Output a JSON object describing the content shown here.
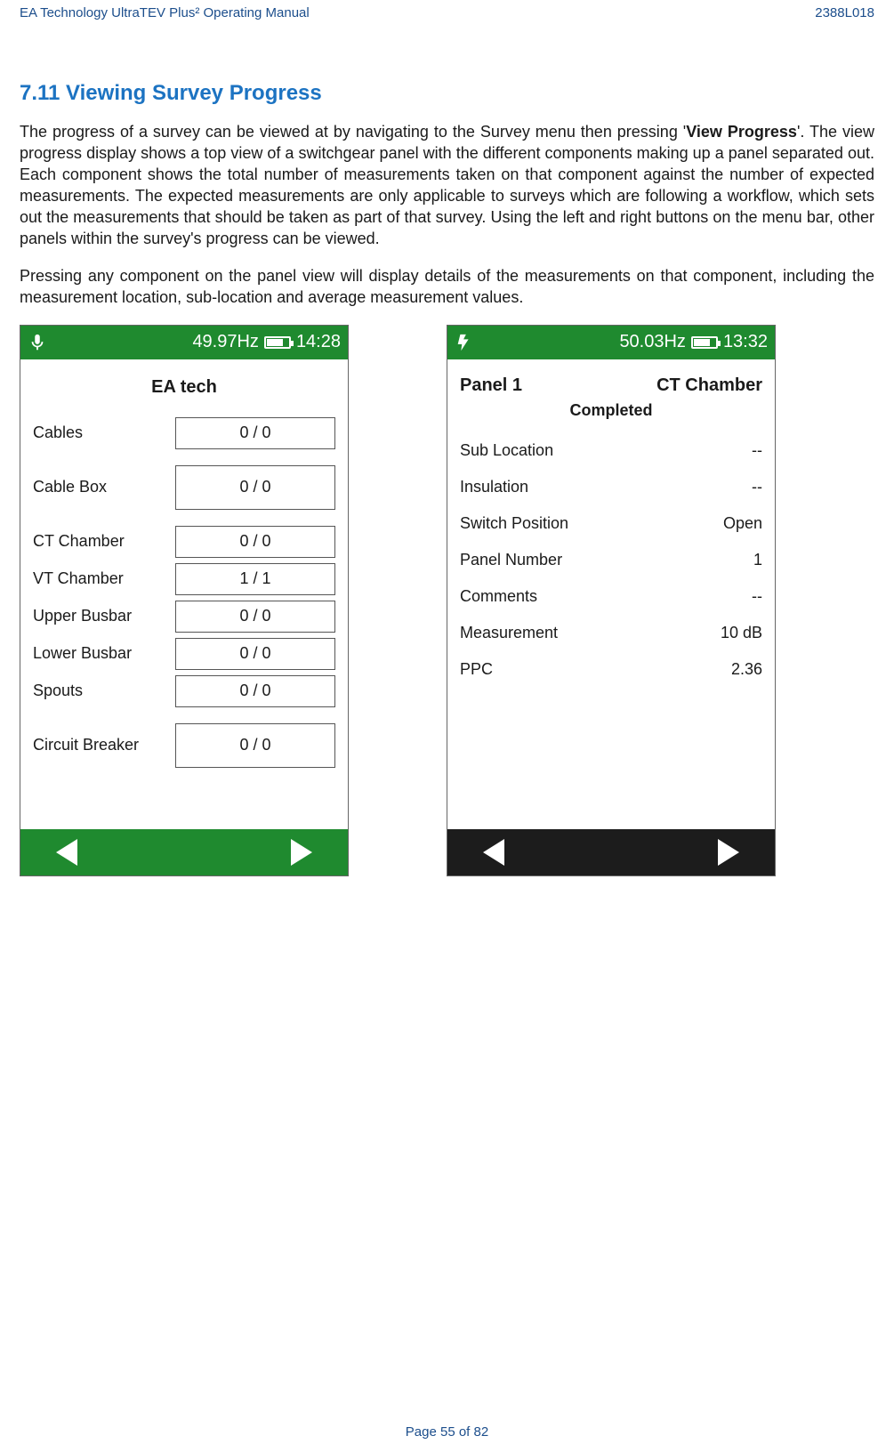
{
  "doc": {
    "header_left": "EA Technology UltraTEV Plus² Operating Manual",
    "header_right": "2388L018",
    "section_title": "7.11  Viewing Survey Progress",
    "para1_a": "The progress of a survey can be viewed at by navigating to the Survey menu then pressing '",
    "para1_bold": "View Progress",
    "para1_b": "'. The view progress display shows a top view of a switchgear panel with the different components making up a panel separated out. Each component shows the total number of measurements taken on that component against the number of expected measurements. The expected measurements are only applicable to surveys which are following a workflow, which sets out the measurements that should be taken as part of that survey. Using the left and right buttons on the menu bar, other panels within the survey's progress can be viewed.",
    "para2": "Pressing any component on the panel view will display details of the measurements on that component, including the measurement location, sub-location and average measurement values.",
    "footer": "Page 55 of 82"
  },
  "left_screen": {
    "hz": "49.97Hz",
    "time": "14:28",
    "title": "EA tech",
    "rows": {
      "cables": {
        "label": "Cables",
        "value": "0 / 0"
      },
      "cable_box": {
        "label": "Cable Box",
        "value": "0 / 0"
      },
      "ct_chamber": {
        "label": "CT Chamber",
        "value": "0 / 0"
      },
      "vt_chamber": {
        "label": "VT Chamber",
        "value": "1 / 1"
      },
      "upper_busbar": {
        "label": "Upper Busbar",
        "value": "0 / 0"
      },
      "lower_busbar": {
        "label": "Lower Busbar",
        "value": "0 / 0"
      },
      "spouts": {
        "label": "Spouts",
        "value": "0 / 0"
      },
      "circuit_breaker": {
        "label": "Circuit Breaker",
        "value": "0 / 0"
      }
    }
  },
  "right_screen": {
    "hz": "50.03Hz",
    "time": "13:32",
    "panel": "Panel 1",
    "component": "CT Chamber",
    "status": "Completed",
    "rows": {
      "sub_location": {
        "label": "Sub Location",
        "value": "--"
      },
      "insulation": {
        "label": "Insulation",
        "value": "--"
      },
      "switch_position": {
        "label": "Switch Position",
        "value": "Open"
      },
      "panel_number": {
        "label": "Panel Number",
        "value": "1"
      },
      "comments": {
        "label": "Comments",
        "value": "--"
      },
      "measurement": {
        "label": "Measurement",
        "value": "10 dB"
      },
      "ppc": {
        "label": "PPC",
        "value": "2.36"
      }
    }
  }
}
